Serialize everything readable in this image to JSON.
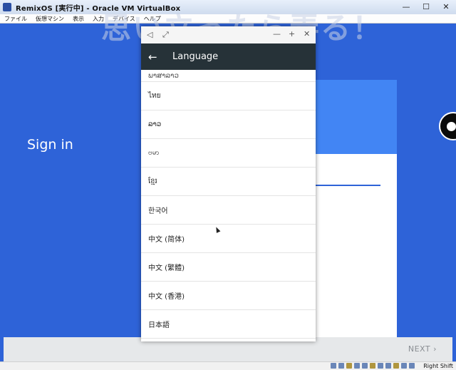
{
  "window": {
    "title": "RemixOS [実行中] - Oracle VM VirtualBox",
    "controls": {
      "minimize": "—",
      "maximize": "☐",
      "close": "✕"
    }
  },
  "menubar": [
    "ファイル",
    "仮想マシン",
    "表示",
    "入力",
    "デバイス",
    "ヘルプ"
  ],
  "watermark": "思い立ったら弄る！",
  "guest": {
    "signin": "Sign in",
    "next_label": "NEXT"
  },
  "dialog": {
    "title_left": [
      "◁",
      "⤢"
    ],
    "title_right": [
      "—",
      "+",
      "✕"
    ],
    "header_back": "←",
    "header_title": "Language",
    "languages": [
      "ພາສາລາວ",
      "ไทย",
      "ລາວ",
      "ဗမာ",
      "ខ្មែរ",
      "한국어",
      "中文 (简体)",
      "中文 (繁體)",
      "中文 (香港)",
      "日本語"
    ]
  },
  "statusbar": {
    "hostkey": "Right Shift"
  }
}
